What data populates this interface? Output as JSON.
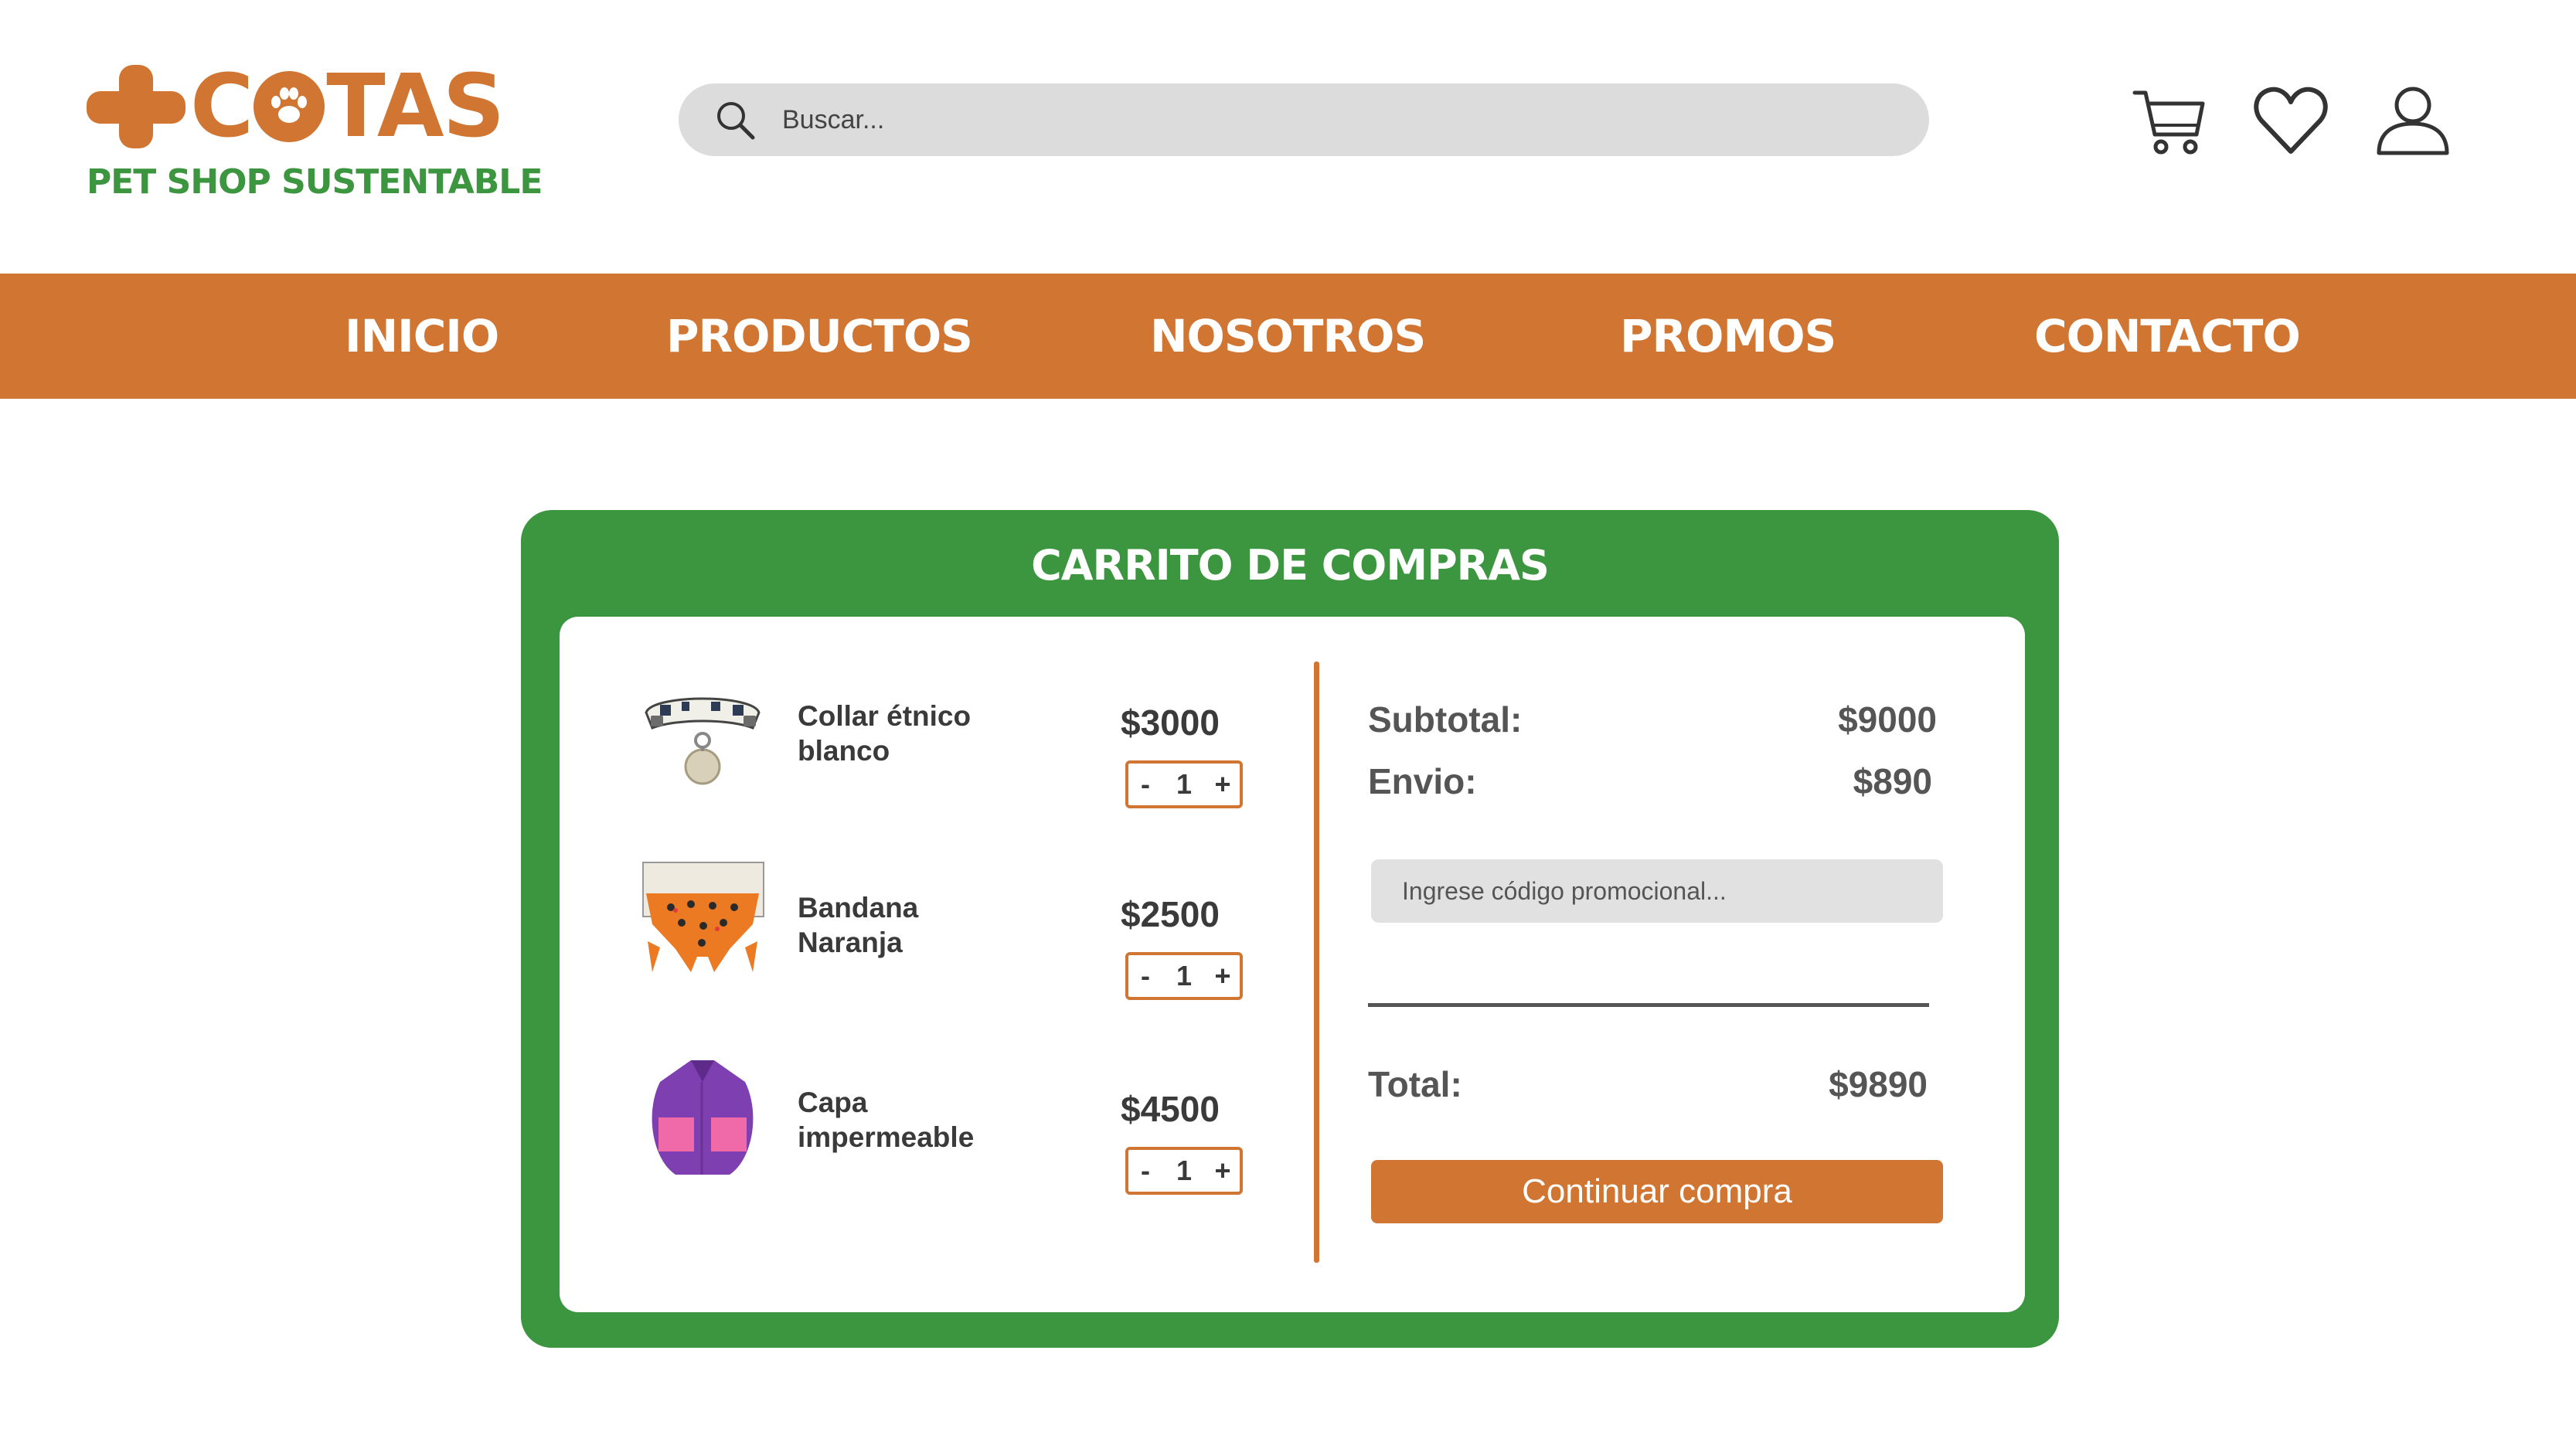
{
  "brand": {
    "name": "COTAS",
    "tagline": "PET SHOP SUSTENTABLE",
    "primary_color": "#d07632",
    "secondary_color": "#3c963f"
  },
  "search": {
    "placeholder": "Buscar..."
  },
  "header_icons": [
    "cart-icon",
    "heart-icon",
    "user-icon"
  ],
  "nav": {
    "items": [
      {
        "label": "INICIO"
      },
      {
        "label": "PRODUCTOS"
      },
      {
        "label": "NOSOTROS"
      },
      {
        "label": "PROMOS"
      },
      {
        "label": "CONTACTO"
      }
    ]
  },
  "cart": {
    "title": "CARRITO DE COMPRAS",
    "items": [
      {
        "name": "Collar étnico blanco",
        "price": "$3000",
        "qty": "1",
        "minus": "-",
        "plus": "+",
        "image": "collar-image"
      },
      {
        "name": "Bandana Naranja",
        "price": "$2500",
        "qty": "1",
        "minus": "-",
        "plus": "+",
        "image": "bandana-image"
      },
      {
        "name": "Capa impermeable",
        "price": "$4500",
        "qty": "1",
        "minus": "-",
        "plus": "+",
        "image": "raincoat-image"
      }
    ],
    "summary": {
      "subtotal_label": "Subtotal:",
      "subtotal_value": "$9000",
      "shipping_label": "Envio:",
      "shipping_value": "$890",
      "promo_placeholder": "Ingrese código promocional...",
      "total_label": "Total:",
      "total_value": "$9890",
      "continue_label": "Continuar compra"
    }
  }
}
